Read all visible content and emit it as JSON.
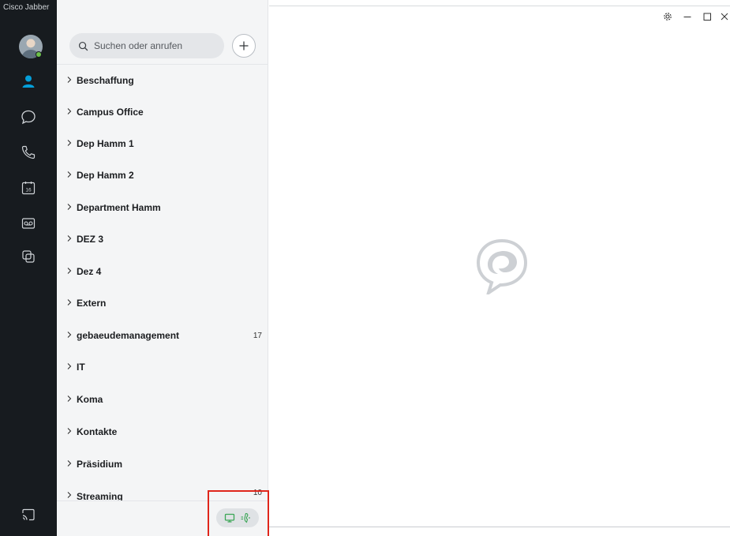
{
  "app": {
    "title": "Cisco Jabber"
  },
  "search": {
    "placeholder": "Suchen oder anrufen"
  },
  "nav": [
    {
      "id": "contacts",
      "icon": "person-icon",
      "active": true
    },
    {
      "id": "chats",
      "icon": "chat-bubble-icon"
    },
    {
      "id": "calls",
      "icon": "phone-icon"
    },
    {
      "id": "meetings",
      "icon": "calendar-icon",
      "badge": "16"
    },
    {
      "id": "voicemail",
      "icon": "voicemail-icon"
    },
    {
      "id": "custom-tabs",
      "icon": "overlap-squares-icon"
    },
    {
      "id": "cast",
      "icon": "screen-cast-icon"
    }
  ],
  "groups": [
    {
      "label": "Beschaffung",
      "count": ""
    },
    {
      "label": "Campus Office",
      "count": ""
    },
    {
      "label": "Dep Hamm 1",
      "count": ""
    },
    {
      "label": "Dep Hamm 2",
      "count": ""
    },
    {
      "label": "Department Hamm",
      "count": ""
    },
    {
      "label": "DEZ 3",
      "count": ""
    },
    {
      "label": "Dez 4",
      "count": ""
    },
    {
      "label": "Extern",
      "count": ""
    },
    {
      "label": "gebaeudemanagement",
      "count": "17"
    },
    {
      "label": "IT",
      "count": ""
    },
    {
      "label": "Koma",
      "count": ""
    },
    {
      "label": "Kontakte",
      "count": ""
    },
    {
      "label": "Präsidium",
      "count": ""
    },
    {
      "label": "Streaming",
      "count": "10"
    }
  ],
  "colors": {
    "rail": "#171b1f",
    "accent": "#049fd9",
    "presence": "#6cc04a",
    "device_green": "#3aa655",
    "highlight": "#e0261b"
  }
}
